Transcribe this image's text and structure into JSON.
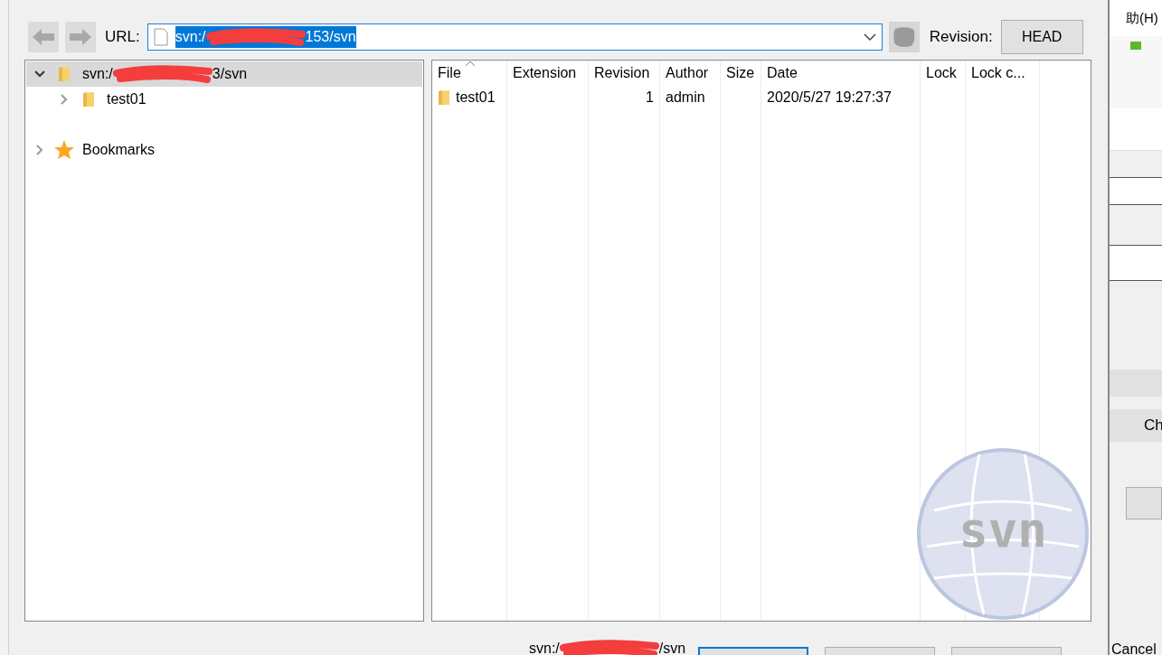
{
  "toolbar": {
    "back": {
      "disabled": true
    },
    "forward": {
      "disabled": true
    },
    "url_label": "URL:",
    "url_start": "svn:/",
    "url_end": "153/svn",
    "url_selected": true,
    "revision_label": "Revision:",
    "revision_button": "HEAD"
  },
  "tree": [
    {
      "kind": "folder",
      "label_start": "svn:/",
      "label_end": "3/svn",
      "expanded": true,
      "selected": true,
      "children": [
        {
          "kind": "folder",
          "label": "test01",
          "expanded": false,
          "selected": false
        }
      ]
    },
    {
      "kind": "bookmark",
      "label": "Bookmarks",
      "expanded": false,
      "selected": false
    }
  ],
  "table": {
    "columns": [
      {
        "label": "File",
        "sorted": true
      },
      {
        "label": "Extension",
        "sorted": false
      },
      {
        "label": "Revision",
        "sorted": false
      },
      {
        "label": "Author",
        "sorted": false
      },
      {
        "label": "Size",
        "sorted": false
      },
      {
        "label": "Date",
        "sorted": false
      },
      {
        "label": "Lock",
        "sorted": false
      },
      {
        "label": "Lock c...",
        "sorted": false
      }
    ],
    "rows": [
      {
        "cells": [
          "test01",
          null,
          "1",
          "admin",
          null,
          "2020/5/27 19:27:37",
          null,
          null
        ]
      }
    ],
    "watermark": "svn"
  },
  "footer": {
    "url_start": "svn:/",
    "url_end": "/svn"
  },
  "background_window": {
    "menu": "助(H)",
    "button": "Ch",
    "cancel": "Cancel"
  }
}
